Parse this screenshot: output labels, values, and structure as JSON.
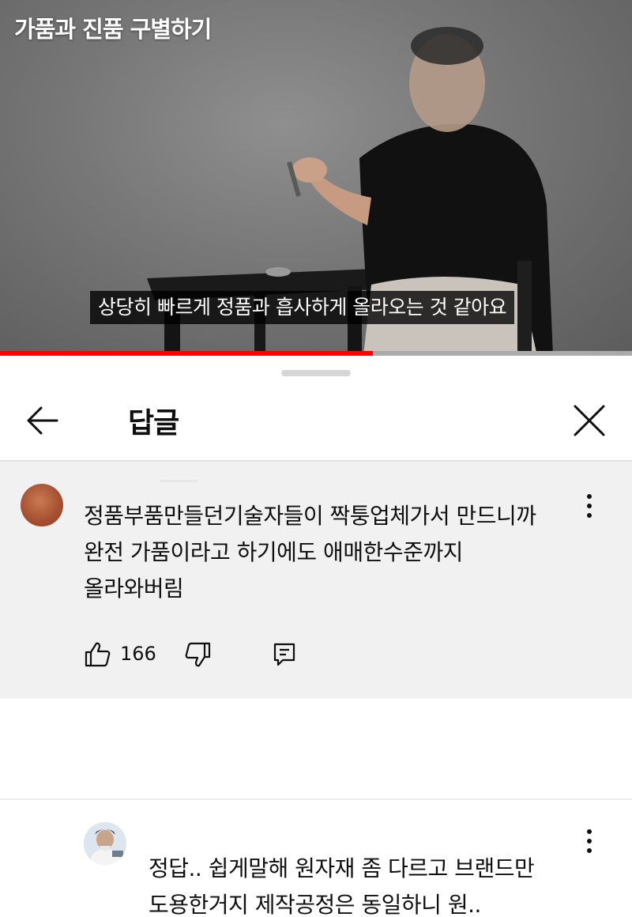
{
  "video": {
    "title": "가품과 진품 구별하기",
    "subtitle": "상당히 빠르게 정품과 흡사하게 올라오는 것 같아요",
    "progress_fraction": 0.59,
    "accent_color": "#ff0000"
  },
  "sheet": {
    "title": "답글",
    "back_icon": "arrow-left-icon",
    "close_icon": "close-icon"
  },
  "parent_comment": {
    "avatar_color": "#a85233",
    "text": "정품부품만들던기술자들이 짝퉁업체가서 만드니까\n완전 가품이라고 하기에도 애매한수준까지\n올라와버림",
    "like_count": "166",
    "icons": [
      "more-vert-icon",
      "thumb-up-icon",
      "thumb-down-icon",
      "reply-icon"
    ]
  },
  "reply_comment": {
    "text": "정답.. 쉽게말해 원자재 좀 다르고 브랜드만\n도용한거지 제작공정은 동일하니 원..",
    "icons": [
      "more-vert-icon"
    ]
  }
}
